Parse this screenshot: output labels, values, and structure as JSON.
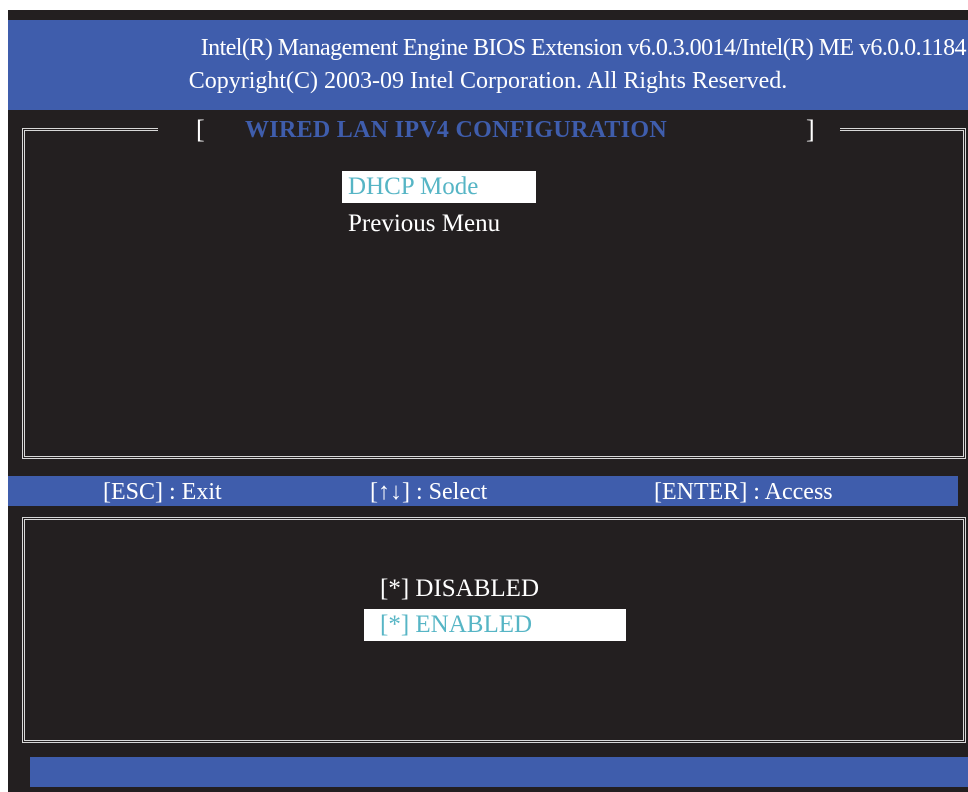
{
  "header": {
    "line1": "Intel(R) Management Engine BIOS Extension v6.0.3.0014/Intel(R) ME v6.0.0.1184",
    "line2": "Copyright(C) 2003-09 Intel Corporation. All Rights Reserved."
  },
  "panel": {
    "bracket_left": "[",
    "title": "WIRED LAN IPV4 CONFIGURATION",
    "bracket_right": "]"
  },
  "menu": {
    "items": [
      {
        "label": "DHCP Mode",
        "selected": true
      },
      {
        "label": "Previous Menu",
        "selected": false
      }
    ]
  },
  "help": {
    "esc": "[ESC] : Exit",
    "select": "[↑↓] : Select",
    "enter": "[ENTER] : Access"
  },
  "options": {
    "items": [
      {
        "label": "[*] DISABLED",
        "selected": false
      },
      {
        "label": "[*] ENABLED",
        "selected": true
      }
    ]
  },
  "colors": {
    "background": "#231f20",
    "bar_blue": "#3f5dac",
    "highlight_bg": "#ffffff",
    "highlight_text": "#56b5c5",
    "text": "#ffffff"
  }
}
